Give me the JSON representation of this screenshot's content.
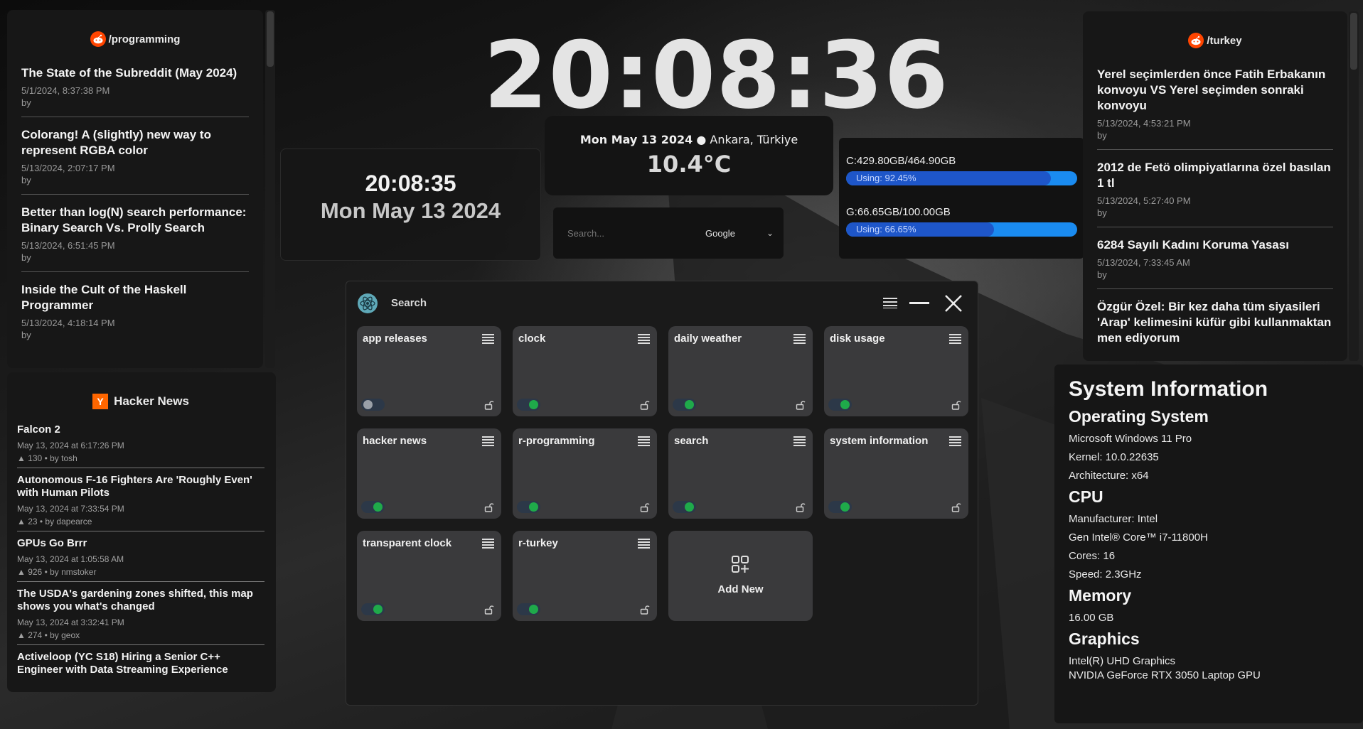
{
  "reddit_programming": {
    "title": "/programming",
    "posts": [
      {
        "title": "The State of the Subreddit (May 2024)",
        "date": "5/1/2024, 8:37:38 PM",
        "by": "by"
      },
      {
        "title": "Colorang! A (slightly) new way to represent RGBA color",
        "date": "5/13/2024, 2:07:17 PM",
        "by": "by"
      },
      {
        "title": "Better than log(N) search performance: Binary Search Vs. Prolly Search",
        "date": "5/13/2024, 6:51:45 PM",
        "by": "by"
      },
      {
        "title": "Inside the Cult of the Haskell Programmer",
        "date": "5/13/2024, 4:18:14 PM",
        "by": "by"
      }
    ]
  },
  "hacker_news": {
    "title": "Hacker News",
    "logo": "Y",
    "items": [
      {
        "title": "Falcon 2",
        "date": "May 13, 2024 at 6:17:26 PM",
        "meta": "▲ 130 • by tosh"
      },
      {
        "title": "Autonomous F-16 Fighters Are 'Roughly Even' with Human Pilots",
        "date": "May 13, 2024 at 7:33:54 PM",
        "meta": "▲ 23 • by dapearce"
      },
      {
        "title": "GPUs Go Brrr",
        "date": "May 13, 2024 at 1:05:58 AM",
        "meta": "▲ 926 • by nmstoker"
      },
      {
        "title": "The USDA's gardening zones shifted, this map shows you what's changed",
        "date": "May 13, 2024 at 3:32:41 PM",
        "meta": "▲ 274 • by geox"
      },
      {
        "title": "Activeloop (YC S18) Hiring a Senior C++ Engineer with Data Streaming Experience",
        "date": "",
        "meta": ""
      }
    ]
  },
  "big_clock": "20:08:36",
  "transparent_clock": {
    "time": "20:08:35",
    "date": "Mon May 13 2024"
  },
  "weather": {
    "date": "Mon May 13 2024",
    "location": "Ankara, Türkiye",
    "temp": "10.4°C"
  },
  "search_widget": {
    "placeholder": "Search...",
    "engine": "Google"
  },
  "disk_usage": {
    "drives": [
      {
        "label": "C:429.80GB/464.90GB",
        "using": "Using: 92.45%",
        "percent": 92.45
      },
      {
        "label": "G:66.65GB/100.00GB",
        "using": "Using: 66.65%",
        "percent": 66.65
      }
    ]
  },
  "reddit_turkey": {
    "title": "/turkey",
    "posts": [
      {
        "title": "Yerel seçimlerden önce Fatih Erbakanın konvoyu VS Yerel seçimden sonraki konvoyu",
        "date": "5/13/2024, 4:53:21 PM",
        "by": "by"
      },
      {
        "title": "2012 de Fetö olimpiyatlarına özel basılan 1 tl",
        "date": "5/13/2024, 5:27:40 PM",
        "by": "by"
      },
      {
        "title": "6284 Sayılı Kadını Koruma Yasası",
        "date": "5/13/2024, 7:33:45 AM",
        "by": "by"
      },
      {
        "title": "Özgür Özel: Bir kez daha tüm siyasileri 'Arap' kelimesini küfür gibi kullanmaktan men ediyorum",
        "date": "",
        "by": ""
      }
    ]
  },
  "manager": {
    "title": "Search",
    "cards": [
      {
        "name": "app releases",
        "enabled": false
      },
      {
        "name": "clock",
        "enabled": true
      },
      {
        "name": "daily weather",
        "enabled": true
      },
      {
        "name": "disk usage",
        "enabled": true
      },
      {
        "name": "hacker news",
        "enabled": true
      },
      {
        "name": "r-programming",
        "enabled": true
      },
      {
        "name": "search",
        "enabled": true
      },
      {
        "name": "system information",
        "enabled": true
      },
      {
        "name": "transparent clock",
        "enabled": true
      },
      {
        "name": "r-turkey",
        "enabled": true
      }
    ],
    "add_new_label": "Add New"
  },
  "system_info": {
    "title": "System Information",
    "os_heading": "Operating System",
    "os_name": "Microsoft Windows 11 Pro",
    "kernel": "Kernel: 10.0.22635",
    "arch": "Architecture: x64",
    "cpu_heading": "CPU",
    "cpu_manufacturer": "Manufacturer: Intel",
    "cpu_gen": "Gen Intel® Core™ i7-11800H",
    "cpu_cores": "Cores: 16",
    "cpu_speed": "Speed: 2.3GHz",
    "memory_heading": "Memory",
    "memory": "16.00 GB",
    "graphics_heading": "Graphics",
    "gpu1": "Intel(R) UHD Graphics",
    "gpu2": "NVIDIA GeForce RTX 3050 Laptop GPU"
  },
  "colors": {
    "reddit": "#ff4500",
    "hn": "#ff6600",
    "toggle_on": "#1faa4a",
    "bar": "#1a8bf0",
    "bar_fill": "#1e56c9"
  }
}
